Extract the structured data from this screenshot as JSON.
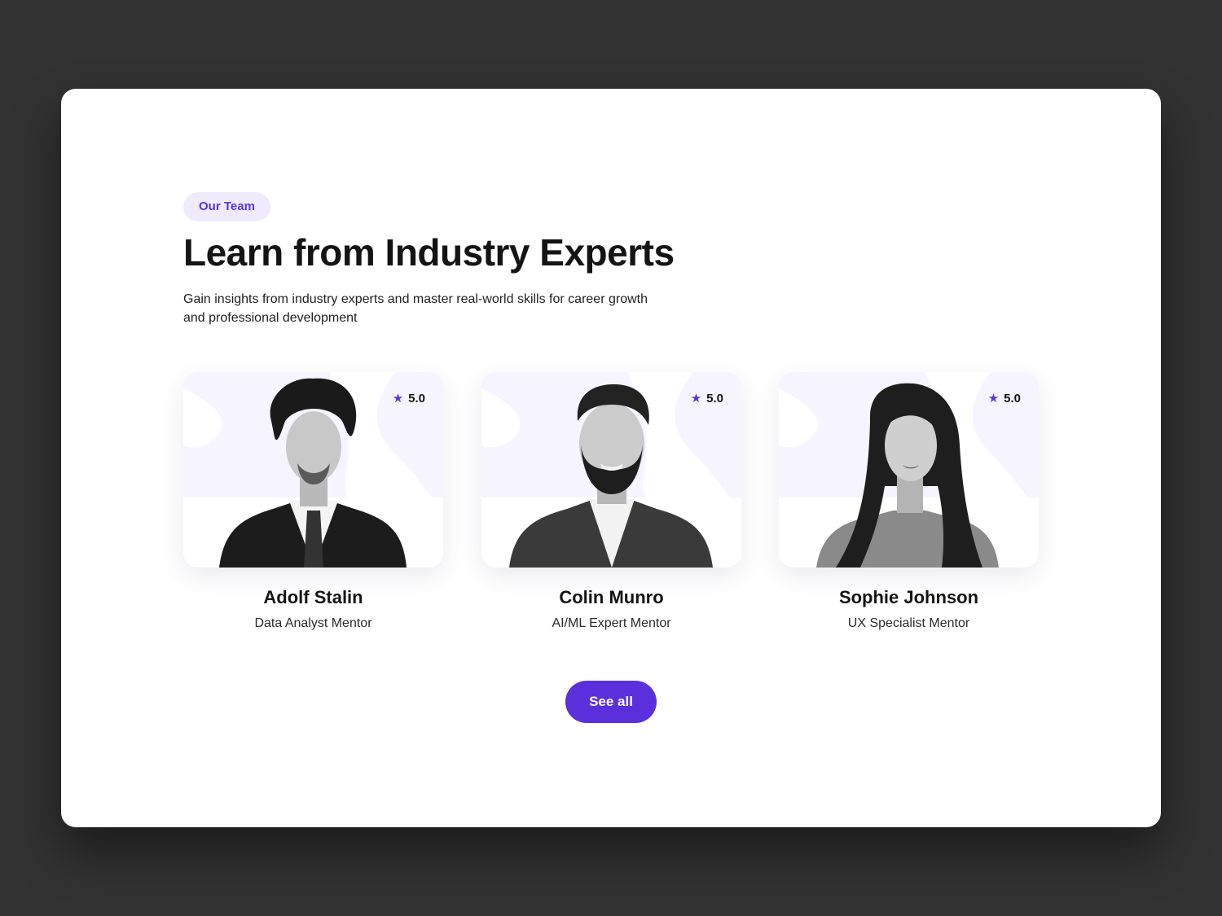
{
  "section": {
    "badge": "Our Team",
    "title": "Learn from Industry Experts",
    "subtitle": "Gain insights from industry experts and master real-world skills for career growth and professional development"
  },
  "mentors": [
    {
      "name": "Adolf Stalin",
      "role": "Data Analyst Mentor",
      "rating": "5.0"
    },
    {
      "name": "Colin Munro",
      "role": "AI/ML Expert Mentor",
      "rating": "5.0"
    },
    {
      "name": "Sophie Johnson",
      "role": "UX Specialist Mentor",
      "rating": "5.0"
    }
  ],
  "cta": {
    "label": "See all"
  },
  "colors": {
    "background": "#323232",
    "accent": "#5b2fdc",
    "badge_bg": "#efebfd",
    "card_bg_shape": "#f6f4fe"
  },
  "icons": {
    "rating": "star-icon"
  }
}
